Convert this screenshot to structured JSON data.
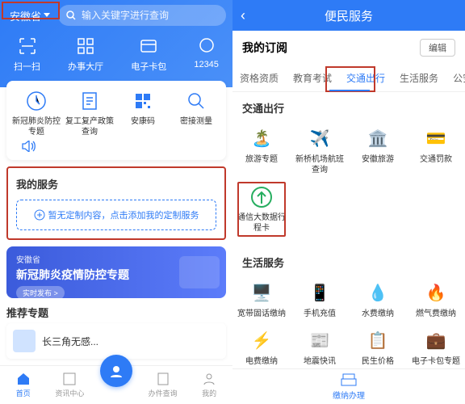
{
  "left": {
    "location": "安徽省",
    "search_placeholder": "输入关键字进行查询",
    "quick": [
      {
        "label": "扫一扫",
        "icon": "scan-icon"
      },
      {
        "label": "办事大厅",
        "icon": "grid-icon"
      },
      {
        "label": "电子卡包",
        "icon": "wallet-icon"
      },
      {
        "label": "12345",
        "icon": "chat-icon"
      }
    ],
    "services": [
      {
        "label": "新冠肺炎防控专题"
      },
      {
        "label": "复工复产政策查询"
      },
      {
        "label": "安康码"
      },
      {
        "label": "密接测量"
      }
    ],
    "my_services_title": "我的服务",
    "my_services_hint": "暂无定制内容，点击添加我的定制服务",
    "banner": {
      "sub": "安徽省",
      "title": "新冠肺炎疫情防控专题",
      "btn": "实时发布 >"
    },
    "recommend_title": "推荐专题",
    "recommend_item": "长三角无感...",
    "nav": [
      "首页",
      "资讯中心",
      "",
      "办件查询",
      "我的"
    ]
  },
  "right": {
    "title": "便民服务",
    "subtitle": "我的订阅",
    "edit": "编辑",
    "tabs": [
      "资格资质",
      "教育考试",
      "交通出行",
      "生活服务",
      "公安服"
    ],
    "active_tab": 2,
    "sec1": "交通出行",
    "sec1_items": [
      {
        "label": "旅游专题",
        "color": "#27ae60"
      },
      {
        "label": "新桥机场航班查询",
        "color": "#27ae60"
      },
      {
        "label": "安徽旅游",
        "color": "#e74c3c"
      },
      {
        "label": "交通罚款",
        "color": "#e74c3c"
      }
    ],
    "sec1_items2": [
      {
        "label": "通信大数据行程卡",
        "color": "#27ae60",
        "boxed": true
      }
    ],
    "sec2": "生活服务",
    "sec2_items": [
      {
        "label": "宽带固话缴纳",
        "color": "#3498db"
      },
      {
        "label": "手机充值",
        "color": "#1abc9c"
      },
      {
        "label": "水费缴纳",
        "color": "#e74c3c"
      },
      {
        "label": "燃气费缴纳",
        "color": "#f39c12"
      },
      {
        "label": "电费缴纳",
        "color": "#f39c12"
      },
      {
        "label": "地震快讯",
        "color": "#f1c40f"
      },
      {
        "label": "民生价格",
        "color": "#e74c3c"
      },
      {
        "label": "电子卡包专题",
        "color": "#3498db"
      }
    ],
    "nav_item": "缴纳办理"
  }
}
